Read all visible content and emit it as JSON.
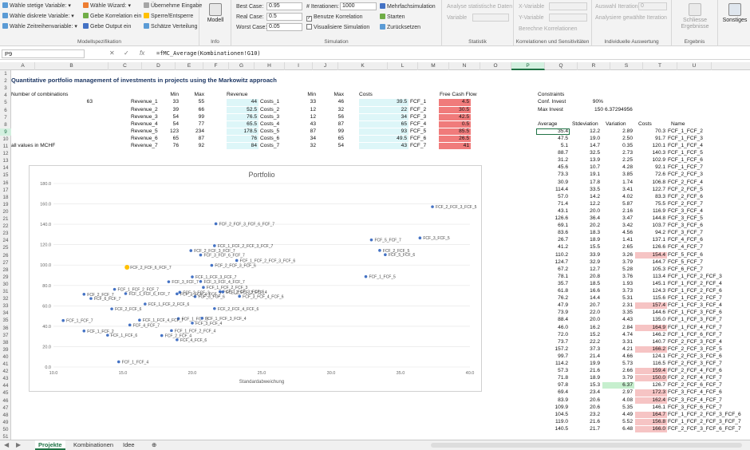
{
  "ribbon": {
    "var_items": [
      "Wähle stetige Variable: ▾",
      "Wähle diskrete Variable: ▾",
      "Wähle Zeitreihenvariable: ▾"
    ],
    "wizard_items": [
      "Wähle Wizard: ▾",
      "Gebe Korrelation ein",
      "Gebe Output ein"
    ],
    "misc_items": [
      "Übernehme Eingabe",
      "Sperre/Entsperre",
      "Schätze Verteilung"
    ],
    "group_modelspec": "Modellspezifikation",
    "modell_label": "Modell",
    "group_info": "Info",
    "best_case_label": "Best Case:",
    "best_case_value": "0.95",
    "real_case_label": "Real Case:",
    "real_case_value": "0.5",
    "worst_case_label": "Worst Case:",
    "worst_case_value": "0.05",
    "iter_label": "# Iterationen:",
    "iter_value": "1000",
    "benutze_korrelation": "Benutze Korrelation",
    "visualisiere": "Visualisiere Simulation",
    "mehrfach": "Mehrfachsimulation",
    "starten": "Starten",
    "zuruecksetzen": "Zurücksetzen",
    "group_simulation": "Simulation",
    "analyse_stat": "Analyse statistische Daten",
    "variable_label": "Variable",
    "group_statistik": "Statistik",
    "x_variable": "X-Variable",
    "y_variable": "Y-Variable",
    "berechne_korrelationen": "Berechne Korrelationen",
    "group_korrelation": "Korrelationen und Sensitivitäten",
    "auswahl_iteration": "Auswahl Iteration:",
    "auswahl_value": "0",
    "analysiere": "Analysiere gewählte Iteration",
    "group_individuelle": "Individuelle Auswertung",
    "schliesse": "Schliesse Ergebnisse",
    "group_ergebnis": "Ergebnis",
    "sonstiges": "Sonstiges"
  },
  "formula_bar": {
    "cell": "P9",
    "formula": "=fMC_Average(Kombinationen!G10)"
  },
  "columns": [
    "A",
    "B",
    "C",
    "D",
    "E",
    "F",
    "G",
    "H",
    "I",
    "J",
    "K",
    "L",
    "M",
    "N",
    "O",
    "P",
    "Q",
    "R",
    "S",
    "T",
    "U"
  ],
  "rows": [
    "1",
    "2",
    "3",
    "4",
    "5",
    "6",
    "7",
    "8",
    "9",
    "10",
    "11",
    "12",
    "13",
    "14",
    "15",
    "16",
    "17",
    "18",
    "19",
    "20",
    "21",
    "22",
    "23",
    "24",
    "25",
    "26",
    "27",
    "28",
    "29",
    "30",
    "31",
    "32",
    "33",
    "34",
    "35",
    "36",
    "37",
    "38",
    "39",
    "40",
    "41",
    "42",
    "43",
    "44",
    "45",
    "46",
    "47",
    "48",
    "49",
    "50",
    "51",
    "52"
  ],
  "sheet": {
    "title": "Quantitative portfolio management of investments in projects using the Markowitz approach",
    "num_combinations_label": "Number of combinations",
    "num_combinations": "63",
    "all_values": "all values in MCHF",
    "hdr_min": "Min",
    "hdr_max": "Max",
    "hdr_revenue": "Revenue",
    "hdr_costs": "Costs",
    "hdr_fcf": "Free Cash Flow",
    "revenue_rows": [
      {
        "name": "Revenue_1",
        "min": "33",
        "max": "55",
        "val": "44"
      },
      {
        "name": "Revenue_2",
        "min": "39",
        "max": "66",
        "val": "52.5"
      },
      {
        "name": "Revenue_3",
        "min": "54",
        "max": "99",
        "val": "76.5"
      },
      {
        "name": "Revenue_4",
        "min": "54",
        "max": "77",
        "val": "65.5"
      },
      {
        "name": "Revenue_5",
        "min": "123",
        "max": "234",
        "val": "178.5"
      },
      {
        "name": "Revenue_6",
        "min": "65",
        "max": "87",
        "val": "76"
      },
      {
        "name": "Revenue_7",
        "min": "76",
        "max": "92",
        "val": "84"
      }
    ],
    "cost_rows": [
      {
        "name": "Costs_1",
        "min": "33",
        "max": "46",
        "val": "39.5"
      },
      {
        "name": "Costs_2",
        "min": "12",
        "max": "32",
        "val": "22"
      },
      {
        "name": "Costs_3",
        "min": "12",
        "max": "56",
        "val": "34"
      },
      {
        "name": "Costs_4",
        "min": "43",
        "max": "87",
        "val": "65"
      },
      {
        "name": "Costs_5",
        "min": "87",
        "max": "99",
        "val": "93"
      },
      {
        "name": "Costs_6",
        "min": "34",
        "max": "65",
        "val": "49.5"
      },
      {
        "name": "Costs_7",
        "min": "32",
        "max": "54",
        "val": "43"
      }
    ],
    "fcf_rows": [
      {
        "name": "FCF_1",
        "val": "4.5"
      },
      {
        "name": "FCF_2",
        "val": "30.5"
      },
      {
        "name": "FCF_3",
        "val": "42.5"
      },
      {
        "name": "FCF_4",
        "val": "0.5"
      },
      {
        "name": "FCF_5",
        "val": "85.5"
      },
      {
        "name": "FCF_6",
        "val": "26.5"
      },
      {
        "name": "FCF_7",
        "val": "41"
      }
    ],
    "constraints_label": "Constraints",
    "conf_invest_label": "Conf. Invest",
    "conf_invest_value": "90%",
    "max_invest_label": "Max Invest",
    "max_invest_value": "150",
    "max_invest_extra": "6.37294956",
    "hdr_average": "Average",
    "hdr_stdev": "Stdeviation",
    "hdr_variation": "Variation",
    "hdr_costs2": "Costs",
    "hdr_name": "Name"
  },
  "result_table": [
    [
      "35.4",
      "12.2",
      "2.89",
      "70.3",
      "FCF_1_FCF_2"
    ],
    [
      "47.5",
      "19.0",
      "2.50",
      "91.7",
      "FCF_1_FCF_3"
    ],
    [
      "5.1",
      "14.7",
      "0.35",
      "120.1",
      "FCF_1_FCF_4"
    ],
    [
      "88.7",
      "32.5",
      "2.73",
      "140.3",
      "FCF_1_FCF_5"
    ],
    [
      "31.2",
      "13.9",
      "2.25",
      "102.9",
      "FCF_1_FCF_6"
    ],
    [
      "45.6",
      "10.7",
      "4.28",
      "92.1",
      "FCF_1_FCF_7"
    ],
    [
      "73.3",
      "19.1",
      "3.85",
      "72.6",
      "FCF_2_FCF_3"
    ],
    [
      "30.9",
      "17.8",
      "1.74",
      "106.8",
      "FCF_2_FCF_4"
    ],
    [
      "114.4",
      "33.5",
      "3.41",
      "122.7",
      "FCF_2_FCF_5"
    ],
    [
      "57.0",
      "14.2",
      "4.02",
      "83.3",
      "FCF_2_FCF_6"
    ],
    [
      "71.4",
      "12.2",
      "5.87",
      "75.5",
      "FCF_2_FCF_7"
    ],
    [
      "43.1",
      "20.0",
      "2.16",
      "116.9",
      "FCF_3_FCF_4"
    ],
    [
      "126.6",
      "36.4",
      "3.47",
      "144.8",
      "FCF_3_FCF_5"
    ],
    [
      "69.1",
      "20.2",
      "3.42",
      "103.7",
      "FCF_3_FCF_6"
    ],
    [
      "83.6",
      "18.3",
      "4.56",
      "94.2",
      "FCF_3_FCF_7"
    ],
    [
      "26.7",
      "18.9",
      "1.41",
      "137.1",
      "FCF_4_FCF_6"
    ],
    [
      "41.2",
      "15.5",
      "2.65",
      "126.6",
      "FCF_4_FCF_7"
    ],
    [
      "110.2",
      "33.9",
      "3.26",
      "154.4",
      "FCF_5_FCF_6"
    ],
    [
      "124.7",
      "32.9",
      "3.79",
      "144.7",
      "FCF_5_FCF_7"
    ],
    [
      "67.2",
      "12.7",
      "5.28",
      "105.3",
      "FCF_6_FCF_7"
    ],
    [
      "78.1",
      "20.8",
      "3.76",
      "113.4",
      "FCF_1_FCF_2_FCF_3"
    ],
    [
      "35.7",
      "18.5",
      "1.93",
      "145.1",
      "FCF_1_FCF_2_FCF_4"
    ],
    [
      "61.8",
      "16.6",
      "3.73",
      "124.3",
      "FCF_1_FCF_2_FCF_6"
    ],
    [
      "76.2",
      "14.4",
      "5.31",
      "115.6",
      "FCF_1_FCF_2_FCF_7"
    ],
    [
      "47.9",
      "20.7",
      "2.31",
      "157.4",
      "FCF_1_FCF_3_FCF_4"
    ],
    [
      "73.9",
      "22.0",
      "3.35",
      "144.6",
      "FCF_1_FCF_3_FCF_6"
    ],
    [
      "88.4",
      "20.0",
      "4.43",
      "135.0",
      "FCF_1_FCF_3_FCF_7"
    ],
    [
      "46.0",
      "16.2",
      "2.84",
      "164.9",
      "FCF_1_FCF_4_FCF_7"
    ],
    [
      "72.0",
      "15.2",
      "4.74",
      "146.2",
      "FCF_1_FCF_6_FCF_7"
    ],
    [
      "73.7",
      "22.2",
      "3.31",
      "140.7",
      "FCF_2_FCF_3_FCF_4"
    ],
    [
      "157.2",
      "37.3",
      "4.21",
      "166.2",
      "FCF_2_FCF_3_FCF_5"
    ],
    [
      "99.7",
      "21.4",
      "4.66",
      "124.1",
      "FCF_2_FCF_3_FCF_6"
    ],
    [
      "114.2",
      "19.9",
      "5.73",
      "116.5",
      "FCF_2_FCF_3_FCF_7"
    ],
    [
      "57.3",
      "21.6",
      "2.66",
      "159.4",
      "FCF_2_FCF_4_FCF_6"
    ],
    [
      "71.8",
      "18.9",
      "3.79",
      "150.0",
      "FCF_2_FCF_4_FCF_7"
    ],
    [
      "97.8",
      "15.3",
      "6.37",
      "126.7",
      "FCF_2_FCF_6_FCF_7"
    ],
    [
      "69.4",
      "23.4",
      "2.97",
      "172.3",
      "FCF_3_FCF_4_FCF_6"
    ],
    [
      "83.9",
      "20.6",
      "4.08",
      "162.4",
      "FCF_3_FCF_4_FCF_7"
    ],
    [
      "109.9",
      "20.6",
      "5.35",
      "146.1",
      "FCF_3_FCF_6_FCF_7"
    ],
    [
      "104.5",
      "23.2",
      "4.49",
      "164.7",
      "FCF_1_FCF_2_FCF_3_FCF_6"
    ],
    [
      "119.0",
      "21.6",
      "5.52",
      "156.8",
      "FCF_1_FCF_2_FCF_3_FCF_7"
    ],
    [
      "140.5",
      "21.7",
      "6.48",
      "166.0",
      "FCF_2_FCF_3_FCF_6_FCF_7"
    ]
  ],
  "highlight": {
    "pink_costs_rows": [
      17,
      24,
      27,
      30,
      33,
      34,
      36,
      37,
      39,
      40,
      41
    ],
    "green_variation_row": 35,
    "pink_color": "#f6c4c4",
    "green_color": "#c6efce",
    "red_color": "#f07b7b",
    "cyan_color": "#ddf6f8",
    "accent": "#217346"
  },
  "chart_data": {
    "type": "scatter",
    "title": "Portfolio",
    "xlabel": "Standardabweichung",
    "ylabel": "",
    "xlim": [
      10,
      40
    ],
    "ylim": [
      0,
      180
    ],
    "xticks": [
      "10.0",
      "15.0",
      "20.0",
      "25.0",
      "30.0",
      "35.0",
      "40.0"
    ],
    "yticks": [
      "0.0",
      "20.0",
      "40.0",
      "60.0",
      "80.0",
      "100.0",
      "120.0",
      "140.0",
      "160.0",
      "180.0"
    ],
    "highlight_label": "FCF_2_FCF_6_FCF_7",
    "points": [
      {
        "x": 12.2,
        "y": 35.4,
        "label": "FCF_1_FCF_2"
      },
      {
        "x": 19.0,
        "y": 47.5,
        "label": "FCF_1_FCF_3"
      },
      {
        "x": 14.7,
        "y": 5.1,
        "label": "FCF_1_FCF_4"
      },
      {
        "x": 32.5,
        "y": 88.7,
        "label": "FCF_1_FCF_5"
      },
      {
        "x": 13.9,
        "y": 31.2,
        "label": "FCF_1_FCF_6"
      },
      {
        "x": 10.7,
        "y": 45.6,
        "label": "FCF_1_FCF_7"
      },
      {
        "x": 19.1,
        "y": 73.3,
        "label": "FCF_2_FCF_3"
      },
      {
        "x": 17.8,
        "y": 30.9,
        "label": "FCF_2_FCF_4"
      },
      {
        "x": 33.5,
        "y": 114.4,
        "label": "FCF_2_FCF_5"
      },
      {
        "x": 14.2,
        "y": 57.0,
        "label": "FCF_2_FCF_6"
      },
      {
        "x": 12.2,
        "y": 71.4,
        "label": "FCF_2_FCF_7"
      },
      {
        "x": 20.0,
        "y": 43.1,
        "label": "FCF_3_FCF_4"
      },
      {
        "x": 36.4,
        "y": 126.6,
        "label": "FCF_3_FCF_5"
      },
      {
        "x": 20.2,
        "y": 69.1,
        "label": "FCF_3_FCF_6"
      },
      {
        "x": 18.3,
        "y": 83.6,
        "label": "FCF_3_FCF_7"
      },
      {
        "x": 18.9,
        "y": 26.7,
        "label": "FCF_4_FCF_6"
      },
      {
        "x": 15.5,
        "y": 41.2,
        "label": "FCF_4_FCF_7"
      },
      {
        "x": 33.9,
        "y": 110.2,
        "label": "FCF_5_FCF_6"
      },
      {
        "x": 32.9,
        "y": 124.7,
        "label": "FCF_5_FCF_7"
      },
      {
        "x": 12.7,
        "y": 67.2,
        "label": "FCF_6_FCF_7"
      },
      {
        "x": 20.8,
        "y": 78.1,
        "label": "FCF_1_FCF_2_FCF_3"
      },
      {
        "x": 18.5,
        "y": 35.7,
        "label": "FCF_1_FCF_2_FCF_4"
      },
      {
        "x": 16.6,
        "y": 61.8,
        "label": "FCF_1_FCF_2_FCF_6"
      },
      {
        "x": 14.4,
        "y": 76.2,
        "label": "FCF_1_FCF_2_FCF_7"
      },
      {
        "x": 20.7,
        "y": 47.9,
        "label": "FCF_1_FCF_3_FCF_4"
      },
      {
        "x": 22.0,
        "y": 73.9,
        "label": "FCF_1_FCF_3_FCF_6"
      },
      {
        "x": 20.0,
        "y": 88.4,
        "label": "FCF_1_FCF_3_FCF_7"
      },
      {
        "x": 16.2,
        "y": 46.0,
        "label": "FCF_1_FCF_4_FCF_7"
      },
      {
        "x": 15.2,
        "y": 72.0,
        "label": "FCF_1_FCF_6_FCF_7"
      },
      {
        "x": 22.2,
        "y": 73.7,
        "label": "FCF_2_FCF_3_FCF_4"
      },
      {
        "x": 37.3,
        "y": 157.2,
        "label": "FCF_2_FCF_3_FCF_5"
      },
      {
        "x": 21.4,
        "y": 99.7,
        "label": "FCF_2_FCF_3_FCF_6"
      },
      {
        "x": 19.9,
        "y": 114.2,
        "label": "FCF_2_FCF_3_FCF_7"
      },
      {
        "x": 21.6,
        "y": 57.3,
        "label": "FCF_2_FCF_4_FCF_6"
      },
      {
        "x": 18.9,
        "y": 71.8,
        "label": "FCF_2_FCF_4_FCF_7"
      },
      {
        "x": 15.3,
        "y": 97.8,
        "label": "FCF_2_FCF_6_FCF_7"
      },
      {
        "x": 23.4,
        "y": 69.4,
        "label": "FCF_3_FCF_4_FCF_6"
      },
      {
        "x": 20.6,
        "y": 83.9,
        "label": "FCF_3_FCF_4_FCF_7"
      },
      {
        "x": 20.6,
        "y": 109.9,
        "label": "FCF_3_FCF_6_FCF_7"
      },
      {
        "x": 23.2,
        "y": 104.5,
        "label": "FCF_1_FCF_2_FCF_3_FCF_6"
      },
      {
        "x": 21.6,
        "y": 119.0,
        "label": "FCF_1_FCF_2_FCF_3_FCF_7"
      },
      {
        "x": 21.7,
        "y": 140.5,
        "label": "FCF_2_FCF_3_FCF_6_FCF_7"
      }
    ]
  },
  "tabs": [
    "Projekte",
    "Kombinationen",
    "Idee"
  ],
  "active_tab": "Projekte"
}
